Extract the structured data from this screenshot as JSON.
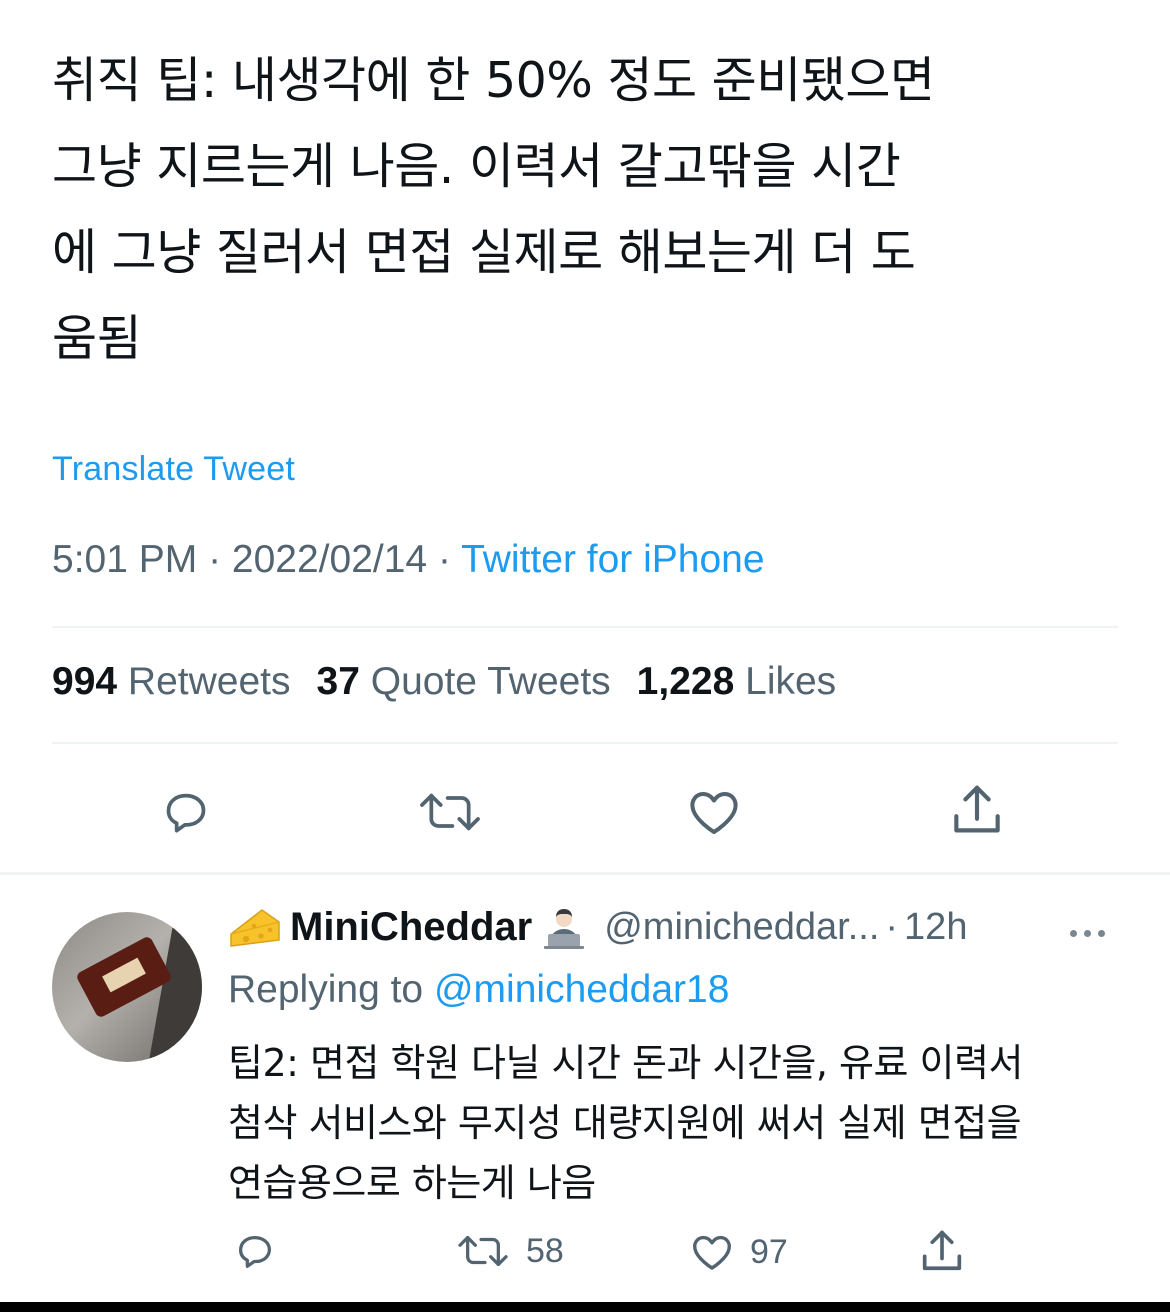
{
  "tweet": {
    "text": "취직 팁: 내생각에 한 50% 정도 준비됐으면\n그냥 지르는게 나음. 이력서 갈고딲을 시간\n에 그냥 질러서 면접 실제로 해보는게 더 도\n움됨",
    "translate_label": "Translate Tweet",
    "time": "5:01 PM",
    "date": "2022/02/14",
    "source": "Twitter for iPhone",
    "stats": {
      "retweets_count": "994",
      "retweets_label": "Retweets",
      "quotes_count": "37",
      "quotes_label": "Quote Tweets",
      "likes_count": "1,228",
      "likes_label": "Likes"
    }
  },
  "reply": {
    "display_name": "MiniCheddar",
    "handle": "@minicheddar...",
    "time": "12h",
    "replying_prefix": "Replying to",
    "replying_to": "@minicheddar18",
    "text": "팁2: 면접 학원 다닐 시간 돈과 시간을, 유료 이력서\n첨삭 서비스와 무지성 대량지원에 써서 실제 면접을\n연습용으로 하는게 나음",
    "retweet_count": "58",
    "like_count": "97"
  },
  "icons": {
    "reply": "reply-icon",
    "retweet": "retweet-icon",
    "like": "heart-icon",
    "share": "share-icon",
    "cheese": "cheese-icon",
    "technologist": "technologist-emoji-icon",
    "more": "more-icon"
  },
  "colors": {
    "accent": "#1d9bf0",
    "secondary_text": "#536471",
    "primary_text": "#0f1419",
    "divider": "#eff3f4"
  }
}
